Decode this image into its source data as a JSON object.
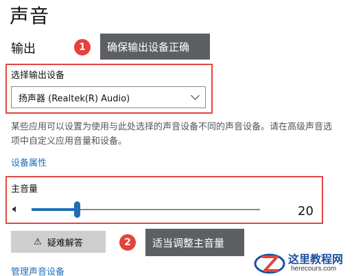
{
  "page": {
    "title": "声音"
  },
  "output_section": {
    "heading": "输出",
    "device_label": "选择输出设备",
    "device_selected": "扬声器 (Realtek(R) Audio)",
    "description": "某些应用可以设置为使用与此处选择的声音设备不同的声音设备。请在高级声音选项中自定义应用音量和设备。",
    "device_properties_link": "设备属性"
  },
  "volume": {
    "label": "主音量",
    "value": "20",
    "level_fraction": 0.2
  },
  "troubleshoot_button": {
    "label": "疑难解答"
  },
  "manage_link": "管理声音设备",
  "callouts": [
    {
      "number": "1",
      "text": "确保输出设备正确"
    },
    {
      "number": "2",
      "text": "适当调整主音量"
    }
  ],
  "watermark": {
    "text": "这里教程网",
    "url": "herecours.com"
  },
  "colors": {
    "accent": "#1f6fb8",
    "highlight": "#e0453f",
    "callout_bg": "#5d6063",
    "callout_num": "#e8403c"
  }
}
